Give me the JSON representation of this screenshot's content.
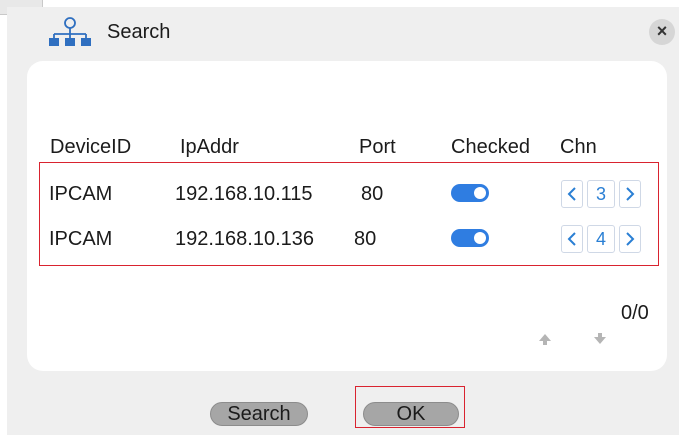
{
  "dialog": {
    "title": "Search",
    "close_glyph": "×"
  },
  "icons": {
    "title": "network-tree-icon",
    "close": "close-icon",
    "prev": "chevron-left-icon",
    "next": "chevron-right-icon",
    "page_up": "arrow-up-icon",
    "page_down": "arrow-down-icon"
  },
  "table": {
    "headers": [
      "DeviceID",
      "IpAddr",
      "Port",
      "Checked",
      "Chn"
    ],
    "rows": [
      {
        "device_id": "IPCAM",
        "ip": "192.168.10.115",
        "port": "80",
        "checked": true,
        "chn": "3"
      },
      {
        "device_id": "IPCAM",
        "ip": "192.168.10.136",
        "port": "80",
        "checked": true,
        "chn": "4"
      }
    ]
  },
  "pager": {
    "text": "0/0"
  },
  "buttons": {
    "search": "Search",
    "ok": "OK"
  },
  "colors": {
    "accent": "#2f7de1",
    "highlight_border": "#d9232f",
    "button_gray": "#a6a6a6"
  }
}
